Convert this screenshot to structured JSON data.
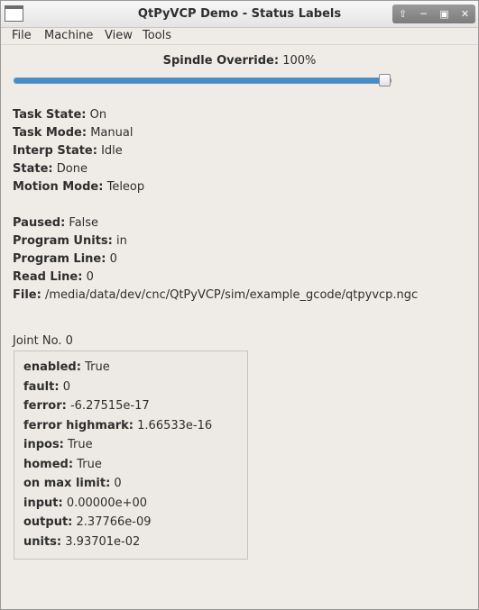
{
  "window": {
    "title": "QtPyVCP Demo - Status Labels"
  },
  "menu": [
    "File",
    "Machine",
    "View",
    "Tools"
  ],
  "spindle": {
    "label": "Spindle Override:",
    "value": "100%",
    "fraction": 0.986
  },
  "status_group1": [
    {
      "label": "Task State:",
      "value": "On"
    },
    {
      "label": "Task Mode:",
      "value": "Manual"
    },
    {
      "label": "Interp State:",
      "value": "Idle"
    },
    {
      "label": "State:",
      "value": "Done"
    },
    {
      "label": "Motion Mode:",
      "value": "Teleop"
    }
  ],
  "status_group2": [
    {
      "label": "Paused:",
      "value": "False"
    },
    {
      "label": "Program Units:",
      "value": "in"
    },
    {
      "label": "Program Line:",
      "value": "0"
    },
    {
      "label": "Read Line:",
      "value": "0"
    },
    {
      "label": "File:",
      "value": "/media/data/dev/cnc/QtPyVCP/sim/example_gcode/qtpyvcp.ngc"
    }
  ],
  "joint": {
    "title": "Joint No. 0",
    "rows": [
      {
        "label": "enabled:",
        "value": "True"
      },
      {
        "label": "fault:",
        "value": "0"
      },
      {
        "label": "ferror:",
        "value": "-6.27515e-17"
      },
      {
        "label": "ferror highmark:",
        "value": "1.66533e-16"
      },
      {
        "label": "inpos:",
        "value": "True"
      },
      {
        "label": "homed:",
        "value": "True"
      },
      {
        "label": "on max limit:",
        "value": "0"
      },
      {
        "label": "input:",
        "value": "0.00000e+00"
      },
      {
        "label": "output:",
        "value": "2.37766e-09"
      },
      {
        "label": "units:",
        "value": "3.93701e-02"
      }
    ]
  }
}
